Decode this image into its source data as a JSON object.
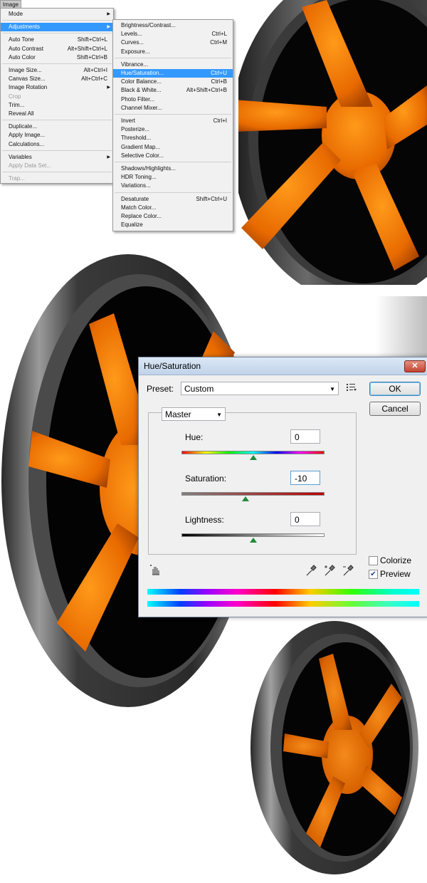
{
  "menu_bar": {
    "image_tab": "Image"
  },
  "image_menu": [
    {
      "label": "Mode",
      "shortcut": "",
      "submenu": true
    },
    {
      "label": "Adjustments",
      "shortcut": "",
      "submenu": true,
      "highlighted": true
    },
    {
      "label": "Auto Tone",
      "shortcut": "Shift+Ctrl+L"
    },
    {
      "label": "Auto Contrast",
      "shortcut": "Alt+Shift+Ctrl+L"
    },
    {
      "label": "Auto Color",
      "shortcut": "Shift+Ctrl+B"
    },
    {
      "label": "Image Size...",
      "shortcut": "Alt+Ctrl+I"
    },
    {
      "label": "Canvas Size...",
      "shortcut": "Alt+Ctrl+C"
    },
    {
      "label": "Image Rotation",
      "shortcut": "",
      "submenu": true
    },
    {
      "label": "Crop",
      "shortcut": "",
      "disabled": true
    },
    {
      "label": "Trim...",
      "shortcut": ""
    },
    {
      "label": "Reveal All",
      "shortcut": ""
    },
    {
      "label": "Duplicate...",
      "shortcut": ""
    },
    {
      "label": "Apply Image...",
      "shortcut": ""
    },
    {
      "label": "Calculations...",
      "shortcut": ""
    },
    {
      "label": "Variables",
      "shortcut": "",
      "submenu": true
    },
    {
      "label": "Apply Data Set...",
      "shortcut": "",
      "disabled": true
    },
    {
      "label": "Trap...",
      "shortcut": "",
      "disabled": true
    }
  ],
  "adjustments_menu": [
    {
      "label": "Brightness/Contrast...",
      "shortcut": ""
    },
    {
      "label": "Levels...",
      "shortcut": "Ctrl+L"
    },
    {
      "label": "Curves...",
      "shortcut": "Ctrl+M"
    },
    {
      "label": "Exposure...",
      "shortcut": ""
    },
    {
      "label": "Vibrance...",
      "shortcut": ""
    },
    {
      "label": "Hue/Saturation...",
      "shortcut": "Ctrl+U",
      "highlighted": true
    },
    {
      "label": "Color Balance...",
      "shortcut": "Ctrl+B"
    },
    {
      "label": "Black & White...",
      "shortcut": "Alt+Shift+Ctrl+B"
    },
    {
      "label": "Photo Filter...",
      "shortcut": ""
    },
    {
      "label": "Channel Mixer...",
      "shortcut": ""
    },
    {
      "label": "Invert",
      "shortcut": "Ctrl+I"
    },
    {
      "label": "Posterize...",
      "shortcut": ""
    },
    {
      "label": "Threshold...",
      "shortcut": ""
    },
    {
      "label": "Gradient Map...",
      "shortcut": ""
    },
    {
      "label": "Selective Color...",
      "shortcut": ""
    },
    {
      "label": "Shadows/Highlights...",
      "shortcut": ""
    },
    {
      "label": "HDR Toning...",
      "shortcut": ""
    },
    {
      "label": "Variations...",
      "shortcut": ""
    },
    {
      "label": "Desaturate",
      "shortcut": "Shift+Ctrl+U"
    },
    {
      "label": "Match Color...",
      "shortcut": ""
    },
    {
      "label": "Replace Color...",
      "shortcut": ""
    },
    {
      "label": "Equalize",
      "shortcut": ""
    }
  ],
  "dialog": {
    "title": "Hue/Saturation",
    "close_glyph": "✕",
    "preset_label": "Preset:",
    "preset_value": "Custom",
    "ok_label": "OK",
    "cancel_label": "Cancel",
    "channel_value": "Master",
    "hue_label": "Hue:",
    "hue_value": "0",
    "saturation_label": "Saturation:",
    "saturation_value": "-10",
    "lightness_label": "Lightness:",
    "lightness_value": "0",
    "colorize_label": "Colorize",
    "colorize_checked": false,
    "preview_label": "Preview",
    "preview_checked": true,
    "slider_positions": {
      "hue": 0.5,
      "saturation": 0.45,
      "lightness": 0.5
    }
  },
  "colors": {
    "menu_highlight": "#3399ff",
    "wheel_orange": "#ff7a00",
    "rim_dark": "#3a3a3a"
  }
}
